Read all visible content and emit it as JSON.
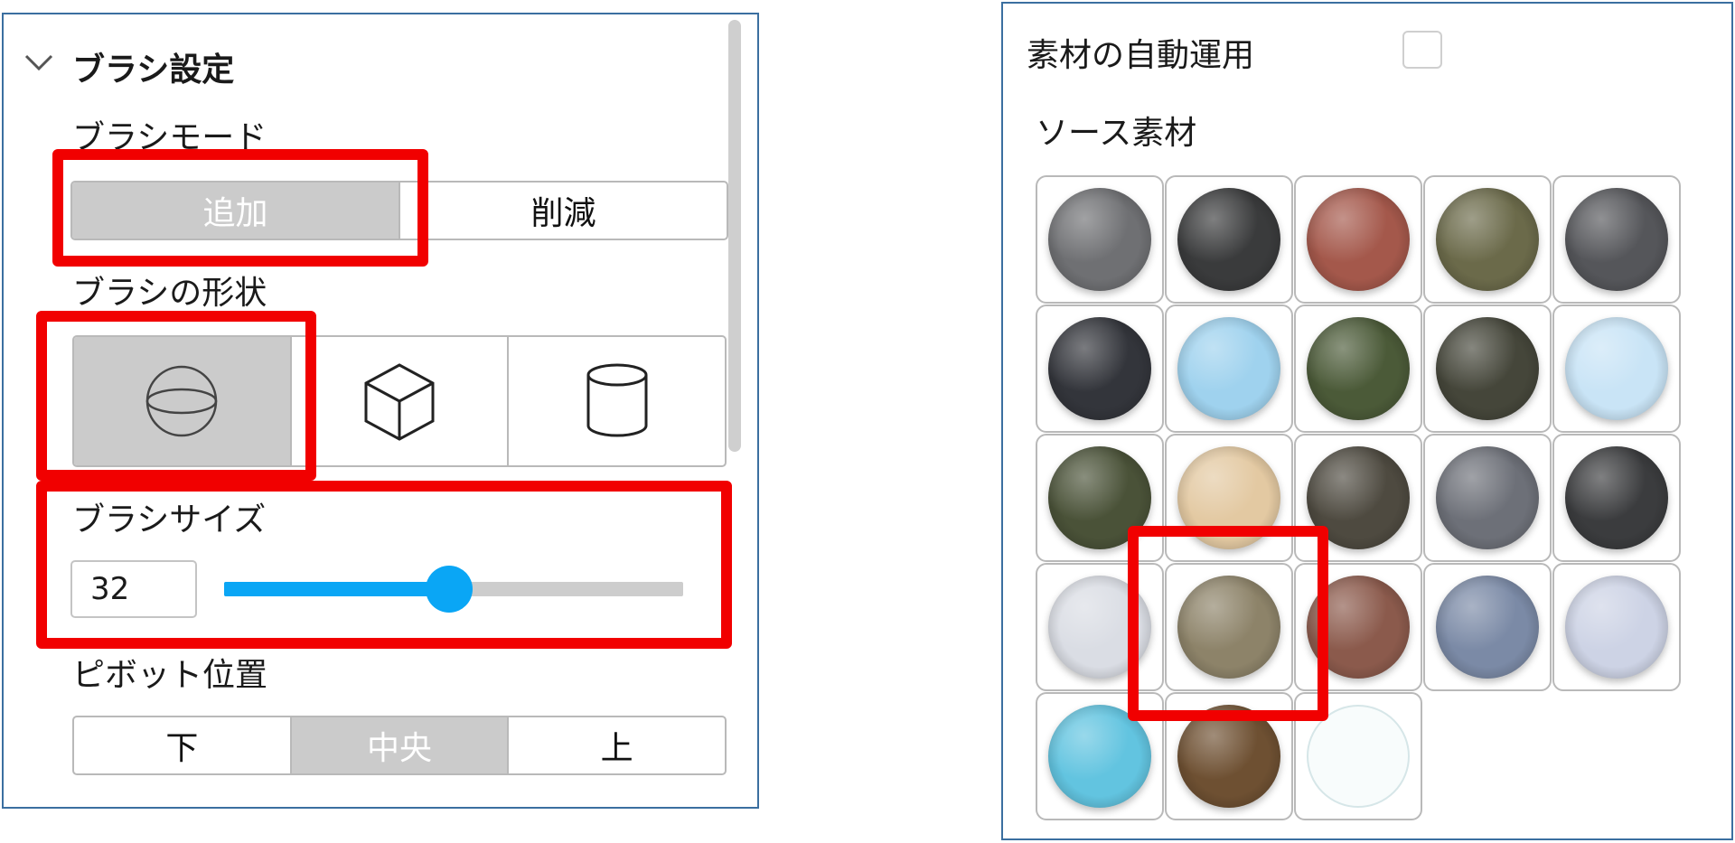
{
  "brush_panel": {
    "section_title": "ブラシ設定",
    "brush_mode": {
      "label": "ブラシモード",
      "options": [
        "追加",
        "削減"
      ],
      "selected": "追加"
    },
    "brush_shape": {
      "label": "ブラシの形状",
      "options": [
        "sphere-icon",
        "cube-icon",
        "cylinder-icon"
      ],
      "selected": "sphere-icon"
    },
    "brush_size": {
      "label": "ブラシサイズ",
      "value": "32",
      "slider_fraction": 0.49
    },
    "pivot": {
      "label": "ピボット位置",
      "options": [
        "下",
        "中央",
        "上"
      ],
      "selected": "中央"
    }
  },
  "material_panel": {
    "auto_apply_label": "素材の自動運用",
    "auto_apply_checked": false,
    "source_label": "ソース素材",
    "materials": [
      {
        "name": "gray-stone",
        "color": "#6f7073"
      },
      {
        "name": "dark-rock",
        "color": "#3a3b3c"
      },
      {
        "name": "brick",
        "color": "#a4584b"
      },
      {
        "name": "mossy-cobble",
        "color": "#6b6a4a"
      },
      {
        "name": "dark-gray",
        "color": "#55565a"
      },
      {
        "name": "dark-cliff",
        "color": "#33353b"
      },
      {
        "name": "ice",
        "color": "#9fd2ee"
      },
      {
        "name": "moss",
        "color": "#4b5a38"
      },
      {
        "name": "dark-soil",
        "color": "#45463a"
      },
      {
        "name": "snow-ice",
        "color": "#c9e4f6"
      },
      {
        "name": "grass-rock",
        "color": "#4a5238"
      },
      {
        "name": "sand",
        "color": "#e3c9a2"
      },
      {
        "name": "mud",
        "color": "#4e4a40"
      },
      {
        "name": "stone-tiles",
        "color": "#6d7078"
      },
      {
        "name": "charcoal-rock",
        "color": "#3b3c3e"
      },
      {
        "name": "snow",
        "color": "#dadde4"
      },
      {
        "name": "dirt",
        "color": "#8d8369"
      },
      {
        "name": "red-clay",
        "color": "#8b5a4c"
      },
      {
        "name": "blue-rock",
        "color": "#7b8aa6"
      },
      {
        "name": "frost",
        "color": "#cdd3e5"
      },
      {
        "name": "water",
        "color": "#62c4e0"
      },
      {
        "name": "wood-planks",
        "color": "#6e5032"
      },
      {
        "name": "empty",
        "color": "#f8fcfc"
      }
    ],
    "selected_index": 16
  }
}
